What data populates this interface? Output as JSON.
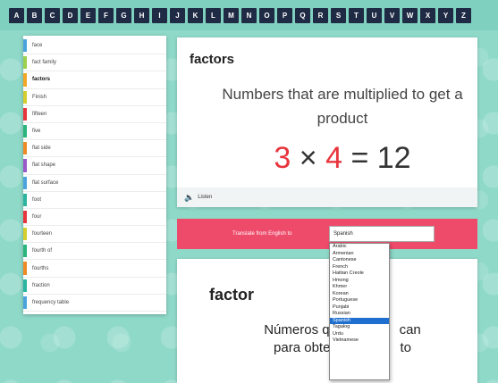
{
  "alphabet": [
    "A",
    "B",
    "C",
    "D",
    "E",
    "F",
    "G",
    "H",
    "I",
    "J",
    "K",
    "L",
    "M",
    "N",
    "O",
    "P",
    "Q",
    "R",
    "S",
    "T",
    "U",
    "V",
    "W",
    "X",
    "Y",
    "Z"
  ],
  "sidebar": {
    "items": [
      {
        "label": "face",
        "color": "#4aa3df"
      },
      {
        "label": "fact family",
        "color": "#9bd14b"
      },
      {
        "label": "factors",
        "color": "#f5a623"
      },
      {
        "label": "Finish",
        "color": "#d6cd2e"
      },
      {
        "label": "fifteen",
        "color": "#e8343c"
      },
      {
        "label": "five",
        "color": "#2ab57d"
      },
      {
        "label": "flat side",
        "color": "#f08a24"
      },
      {
        "label": "flat shape",
        "color": "#9a59c9"
      },
      {
        "label": "flat surface",
        "color": "#4aa3df"
      },
      {
        "label": "foot",
        "color": "#2ab5a0"
      },
      {
        "label": "four",
        "color": "#e8343c"
      },
      {
        "label": "fourteen",
        "color": "#d6cd2e"
      },
      {
        "label": "fourth of",
        "color": "#2ab57d"
      },
      {
        "label": "fourths",
        "color": "#f08a24"
      },
      {
        "label": "fraction",
        "color": "#2ab5a0"
      },
      {
        "label": "frequency table",
        "color": "#4aa3df"
      }
    ],
    "selected_index": 2
  },
  "word_card": {
    "title": "factors",
    "definition": "Numbers that are multiplied to get a product",
    "equation": {
      "a": "3",
      "op": "×",
      "b": "4",
      "eq": "=",
      "result": "12"
    },
    "listen_label": "Listen"
  },
  "translate": {
    "label": "Translate from English to",
    "selected_language": "Spanish",
    "options": [
      "Arabic",
      "Armenian",
      "Cantonese",
      "French",
      "Haitian Creole",
      "Hmong",
      "Khmer",
      "Korean",
      "Portuguese",
      "Punjabi",
      "Russian",
      "Spanish",
      "Tagalog",
      "Urdu",
      "Vietnamese"
    ],
    "highlight_index": 11
  },
  "translation_card": {
    "title": "factor",
    "definition_line1": "Números q",
    "definition_line1_end": "can",
    "definition_line2": "para obte",
    "definition_line2_end": "to"
  },
  "colors": {
    "accent": "#ee4b6a",
    "background": "#8fd9c9",
    "alpha_button": "#1f2a44"
  }
}
